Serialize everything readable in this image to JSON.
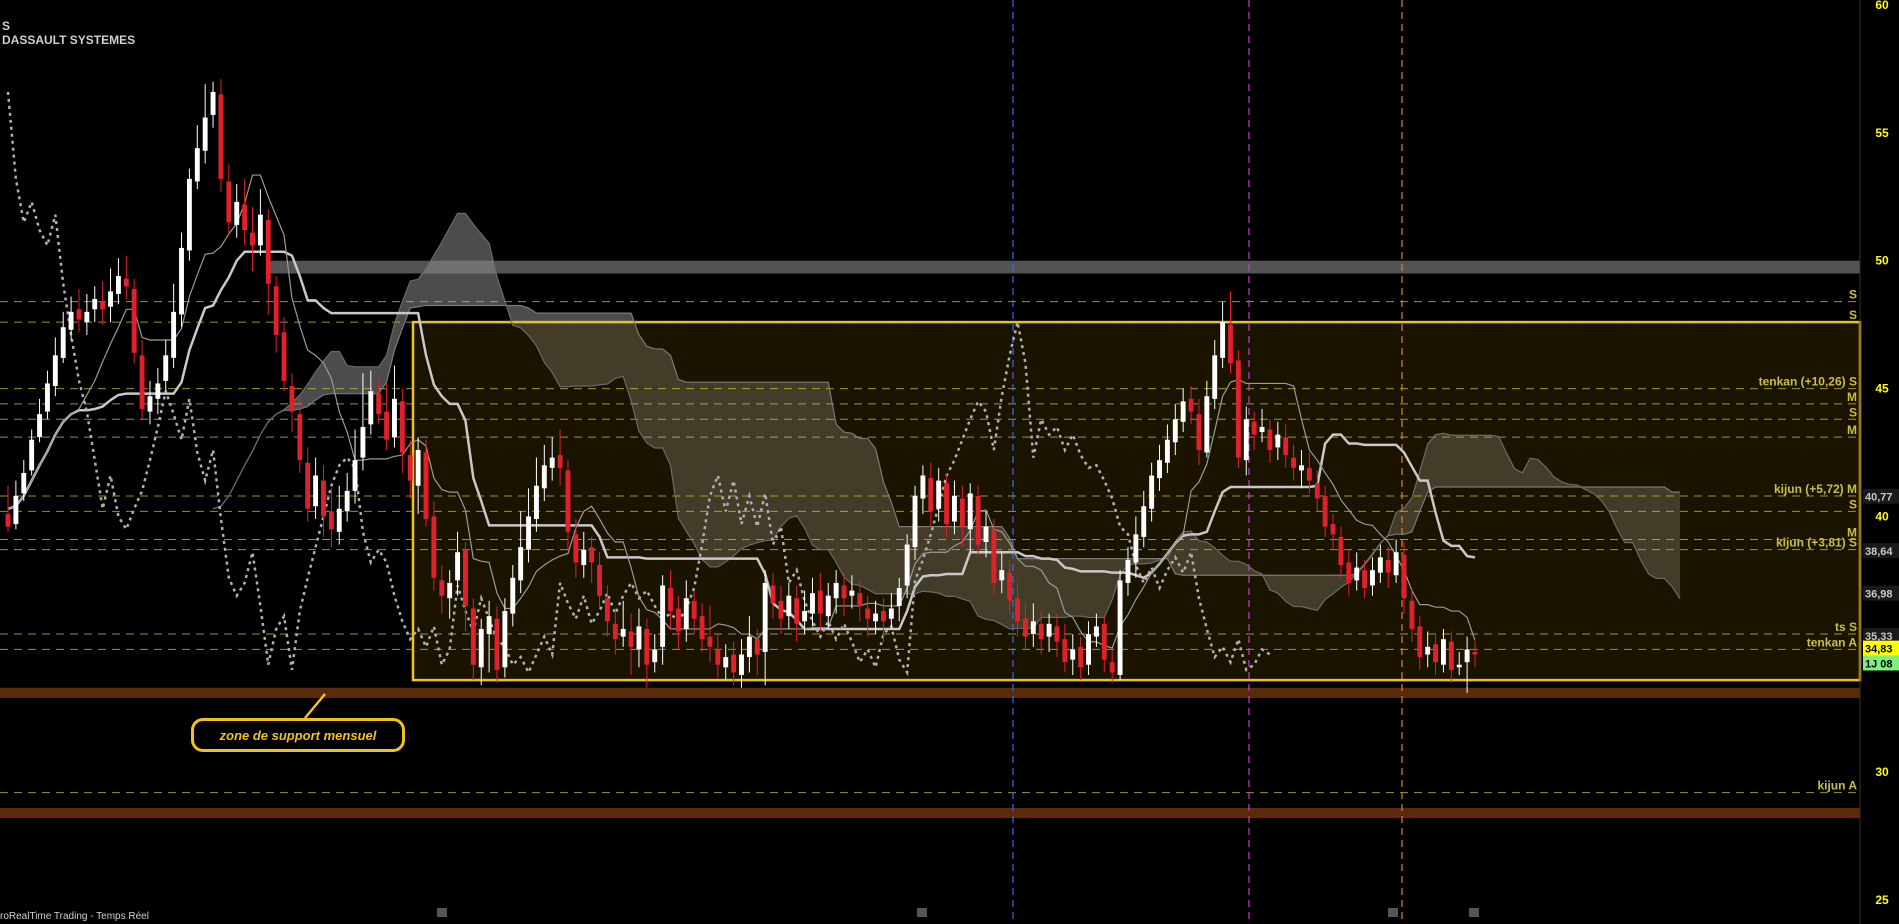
{
  "header": {
    "ticker": "S",
    "name": "DASSAULT SYSTEMES"
  },
  "footer": {
    "source": "roRealTime Trading - Temps Réel"
  },
  "annotation": {
    "label": "zone de support mensuel"
  },
  "colors": {
    "background": "#000000",
    "up_candle": "#ffffff",
    "down_candle": "#e0202a",
    "range_box": "#f0c21c",
    "level_line": "#c8c23a",
    "support_band": "#5a2a0a",
    "cloud": "#8a8a8a",
    "label_yellow": "#ffff00",
    "label_green": "#7ef07e"
  },
  "chart_data": {
    "type": "candlestick",
    "title": "DASSAULT SYSTEMES",
    "ylim": [
      25,
      60
    ],
    "y_ticks": [
      25,
      30,
      40,
      45,
      50,
      55,
      60
    ],
    "grid": false,
    "price_labels": [
      {
        "text": "40,77",
        "value": 40.77,
        "style": "gray"
      },
      {
        "text": "38,64",
        "value": 38.64,
        "style": "gray"
      },
      {
        "text": "36,98",
        "value": 36.98,
        "style": "gray"
      },
      {
        "text": "35,33",
        "value": 35.33,
        "style": "gray"
      },
      {
        "text": "34,83",
        "value": 34.83,
        "style": "yellow"
      },
      {
        "text": "1J 08",
        "value": 34.25,
        "style": "green"
      }
    ],
    "level_lines": [
      {
        "label": "S",
        "value": 48.4
      },
      {
        "label": "S",
        "value": 47.6
      },
      {
        "label": "tenkan (+10,26) S",
        "value": 45.0
      },
      {
        "label": "M",
        "value": 44.4
      },
      {
        "label": "S",
        "value": 43.8
      },
      {
        "label": "M",
        "value": 43.1
      },
      {
        "label": "kijun (+5,72) M",
        "value": 40.8
      },
      {
        "label": "S",
        "value": 40.2
      },
      {
        "label": "M",
        "value": 39.1
      },
      {
        "label": "kijun (+3,81) S",
        "value": 38.7
      },
      {
        "label": "ts S",
        "value": 35.4
      },
      {
        "label": "tenkan A",
        "value": 34.8
      },
      {
        "label": "kijun A",
        "value": 29.2
      }
    ],
    "range_box": {
      "top": 47.6,
      "bottom": 33.6
    },
    "resistance_band": {
      "top": 50.0,
      "bottom": 49.5
    },
    "support_zones": [
      {
        "top": 33.3,
        "bottom": 32.9
      },
      {
        "top": 28.6,
        "bottom": 28.2
      }
    ],
    "vertical_markers": [
      {
        "color": "#3a6fd8"
      },
      {
        "color": "#c040c0"
      },
      {
        "color": "#d08a2a"
      }
    ],
    "candles": [
      [
        40.1,
        39.6,
        41.2,
        39.4
      ],
      [
        39.7,
        40.8,
        41.4,
        39.5
      ],
      [
        40.9,
        41.7,
        42.2,
        40.6
      ],
      [
        41.8,
        43.0,
        43.4,
        41.6
      ],
      [
        43.1,
        44.0,
        44.6,
        42.9
      ],
      [
        44.1,
        45.2,
        45.7,
        43.8
      ],
      [
        45.1,
        46.3,
        47.0,
        44.7
      ],
      [
        46.2,
        47.4,
        48.0,
        46.0
      ],
      [
        47.3,
        48.0,
        48.6,
        46.9
      ],
      [
        48.1,
        47.7,
        48.9,
        47.2
      ],
      [
        47.6,
        48.0,
        48.7,
        47.1
      ],
      [
        48.1,
        48.5,
        49.0,
        47.6
      ],
      [
        48.4,
        48.1,
        49.2,
        47.5
      ],
      [
        48.2,
        48.8,
        49.7,
        47.6
      ],
      [
        48.7,
        49.4,
        50.1,
        48.3
      ],
      [
        49.3,
        49.0,
        50.2,
        48.5
      ],
      [
        48.9,
        46.4,
        49.3,
        46.0
      ],
      [
        46.3,
        44.2,
        46.9,
        43.8
      ],
      [
        44.1,
        44.7,
        45.3,
        43.6
      ],
      [
        44.6,
        45.2,
        45.8,
        44.0
      ],
      [
        45.3,
        46.3,
        46.9,
        45.0
      ],
      [
        46.2,
        48.0,
        49.1,
        45.8
      ],
      [
        47.9,
        50.5,
        51.1,
        47.4
      ],
      [
        50.4,
        53.2,
        53.6,
        50.0
      ],
      [
        53.1,
        54.4,
        55.3,
        52.8
      ],
      [
        54.3,
        55.6,
        56.9,
        53.8
      ],
      [
        55.7,
        56.6,
        57.0,
        55.2
      ],
      [
        56.5,
        53.2,
        57.1,
        52.7
      ],
      [
        53.1,
        51.5,
        53.8,
        51.0
      ],
      [
        51.4,
        52.3,
        53.0,
        50.9
      ],
      [
        52.2,
        51.2,
        53.2,
        50.6
      ],
      [
        51.1,
        50.6,
        52.1,
        49.6
      ],
      [
        50.6,
        51.8,
        52.8,
        50.2
      ],
      [
        51.6,
        49.1,
        52.0,
        47.9
      ],
      [
        49.0,
        47.1,
        49.4,
        46.4
      ],
      [
        47.2,
        45.3,
        47.8,
        44.9
      ],
      [
        45.1,
        44.1,
        45.6,
        43.3
      ],
      [
        44.0,
        42.2,
        44.6,
        41.7
      ],
      [
        42.1,
        40.3,
        42.7,
        39.8
      ],
      [
        40.4,
        41.6,
        42.3,
        39.9
      ],
      [
        41.4,
        40.0,
        42.0,
        39.2
      ],
      [
        40.2,
        39.5,
        41.1,
        38.8
      ],
      [
        39.4,
        40.3,
        41.2,
        38.9
      ],
      [
        40.2,
        41.0,
        41.7,
        39.8
      ],
      [
        41.0,
        42.2,
        43.4,
        40.5
      ],
      [
        42.3,
        43.5,
        45.6,
        41.8
      ],
      [
        43.6,
        44.9,
        45.7,
        43.2
      ],
      [
        44.8,
        44.0,
        45.4,
        43.6
      ],
      [
        44.1,
        43.0,
        45.2,
        42.6
      ],
      [
        43.1,
        44.6,
        45.9,
        42.7
      ],
      [
        44.5,
        42.5,
        45.0,
        41.7
      ],
      [
        42.4,
        41.4,
        43.0,
        40.7
      ],
      [
        41.2,
        42.6,
        43.1,
        40.1
      ],
      [
        42.5,
        39.9,
        43.0,
        39.6
      ],
      [
        40.0,
        37.6,
        40.6,
        37.1
      ],
      [
        37.5,
        36.9,
        38.1,
        36.2
      ],
      [
        36.8,
        37.4,
        37.9,
        36.0
      ],
      [
        37.5,
        38.6,
        39.4,
        36.9
      ],
      [
        38.7,
        36.5,
        39.0,
        35.5
      ],
      [
        36.4,
        34.2,
        36.8,
        33.6
      ],
      [
        34.1,
        35.6,
        36.0,
        33.4
      ],
      [
        35.4,
        36.1,
        36.7,
        33.9
      ],
      [
        36.0,
        34.0,
        36.5,
        33.5
      ],
      [
        34.1,
        36.3,
        36.8,
        33.7
      ],
      [
        36.2,
        37.6,
        38.1,
        35.7
      ],
      [
        37.5,
        38.8,
        40.2,
        37.0
      ],
      [
        38.7,
        40.0,
        41.1,
        38.2
      ],
      [
        39.9,
        41.2,
        42.3,
        39.4
      ],
      [
        41.1,
        42.0,
        42.8,
        40.6
      ],
      [
        41.9,
        42.3,
        43.1,
        41.4
      ],
      [
        42.4,
        41.9,
        43.4,
        41.2
      ],
      [
        41.8,
        39.4,
        42.2,
        38.7
      ],
      [
        39.3,
        38.2,
        39.9,
        37.6
      ],
      [
        38.1,
        38.7,
        39.4,
        37.6
      ],
      [
        38.8,
        38.2,
        39.2,
        37.4
      ],
      [
        38.1,
        36.9,
        38.6,
        36.4
      ],
      [
        36.8,
        35.9,
        37.3,
        35.3
      ],
      [
        35.8,
        35.2,
        36.4,
        34.6
      ],
      [
        35.3,
        35.6,
        36.7,
        34.9
      ],
      [
        35.5,
        34.9,
        36.2,
        33.8
      ],
      [
        34.8,
        35.7,
        36.4,
        34.1
      ],
      [
        35.6,
        34.2,
        36.0,
        33.3
      ],
      [
        34.3,
        34.8,
        35.4,
        33.9
      ],
      [
        34.9,
        37.3,
        37.7,
        34.2
      ],
      [
        37.2,
        36.3,
        37.9,
        35.6
      ],
      [
        36.4,
        35.5,
        36.9,
        34.8
      ],
      [
        35.6,
        36.8,
        37.5,
        35.1
      ],
      [
        36.7,
        36.0,
        37.1,
        35.4
      ],
      [
        36.1,
        35.2,
        36.6,
        34.7
      ],
      [
        35.3,
        34.9,
        36.5,
        34.3
      ],
      [
        34.8,
        34.2,
        35.4,
        33.7
      ],
      [
        34.1,
        34.5,
        35.0,
        33.6
      ],
      [
        34.6,
        33.9,
        35.1,
        33.4
      ],
      [
        33.8,
        34.6,
        35.2,
        33.3
      ],
      [
        34.5,
        35.3,
        36.1,
        33.9
      ],
      [
        35.2,
        34.6,
        35.6,
        33.8
      ],
      [
        34.7,
        37.4,
        37.9,
        33.4
      ],
      [
        37.3,
        36.6,
        37.8,
        36.0
      ],
      [
        36.7,
        36.0,
        37.3,
        35.4
      ],
      [
        36.1,
        36.9,
        37.4,
        35.6
      ],
      [
        36.8,
        35.8,
        37.3,
        35.1
      ],
      [
        35.9,
        36.3,
        37.1,
        35.4
      ],
      [
        36.2,
        37.0,
        37.6,
        35.7
      ],
      [
        37.1,
        36.2,
        37.8,
        35.5
      ],
      [
        36.1,
        36.9,
        37.4,
        35.6
      ],
      [
        36.8,
        37.4,
        37.9,
        36.2
      ],
      [
        37.3,
        36.8,
        37.8,
        36.1
      ],
      [
        36.9,
        37.1,
        37.7,
        36.4
      ],
      [
        37.0,
        36.5,
        37.5,
        35.9
      ],
      [
        36.4,
        36.0,
        36.9,
        35.3
      ],
      [
        35.9,
        36.2,
        36.7,
        35.4
      ],
      [
        36.3,
        35.9,
        36.8,
        35.1
      ],
      [
        36.0,
        36.4,
        37.0,
        35.6
      ],
      [
        36.5,
        37.2,
        37.6,
        35.9
      ],
      [
        37.3,
        38.9,
        39.3,
        36.8
      ],
      [
        38.8,
        40.8,
        41.2,
        38.3
      ],
      [
        40.7,
        41.6,
        42.0,
        40.1
      ],
      [
        41.5,
        40.2,
        42.1,
        39.6
      ],
      [
        40.3,
        41.4,
        41.9,
        39.8
      ],
      [
        41.3,
        39.7,
        41.7,
        39.2
      ],
      [
        39.8,
        40.8,
        41.4,
        39.3
      ],
      [
        40.7,
        39.6,
        41.2,
        38.8
      ],
      [
        39.5,
        40.9,
        41.3,
        38.6
      ],
      [
        40.8,
        38.9,
        41.2,
        38.5
      ],
      [
        39.0,
        39.6,
        40.2,
        38.4
      ],
      [
        39.5,
        37.4,
        39.9,
        36.9
      ],
      [
        37.5,
        37.9,
        38.6,
        37.0
      ],
      [
        37.8,
        36.7,
        38.3,
        36.2
      ],
      [
        36.8,
        35.9,
        37.4,
        35.3
      ],
      [
        36.0,
        35.3,
        36.6,
        34.8
      ],
      [
        35.4,
        35.9,
        36.6,
        34.9
      ],
      [
        35.8,
        35.2,
        36.3,
        34.6
      ],
      [
        35.3,
        35.8,
        36.2,
        34.7
      ],
      [
        35.7,
        35.1,
        36.2,
        34.5
      ],
      [
        35.2,
        34.3,
        35.8,
        33.9
      ],
      [
        34.4,
        34.8,
        35.4,
        33.8
      ],
      [
        34.9,
        34.1,
        35.3,
        33.6
      ],
      [
        34.2,
        35.4,
        35.9,
        33.8
      ],
      [
        35.3,
        35.7,
        36.2,
        34.9
      ],
      [
        35.8,
        34.4,
        36.1,
        33.9
      ],
      [
        34.3,
        33.9,
        34.8,
        33.5
      ],
      [
        33.8,
        37.5,
        37.9,
        33.6
      ],
      [
        37.4,
        38.3,
        38.8,
        36.9
      ],
      [
        38.2,
        39.3,
        40.0,
        37.6
      ],
      [
        39.2,
        40.4,
        41.0,
        38.8
      ],
      [
        40.3,
        41.6,
        42.1,
        39.8
      ],
      [
        41.5,
        42.2,
        42.8,
        41.0
      ],
      [
        42.1,
        43.0,
        43.6,
        41.7
      ],
      [
        42.9,
        43.8,
        44.4,
        42.4
      ],
      [
        43.7,
        44.5,
        45.0,
        43.3
      ],
      [
        44.6,
        44.1,
        45.1,
        43.6
      ],
      [
        44.0,
        42.6,
        44.6,
        42.0
      ],
      [
        42.5,
        44.7,
        45.3,
        42.3
      ],
      [
        44.6,
        46.3,
        46.9,
        44.2
      ],
      [
        46.2,
        47.6,
        48.4,
        45.8
      ],
      [
        47.5,
        46.0,
        48.8,
        45.6
      ],
      [
        46.1,
        42.3,
        46.5,
        41.9
      ],
      [
        42.2,
        43.8,
        44.3,
        41.6
      ],
      [
        43.7,
        43.2,
        44.1,
        42.6
      ],
      [
        43.3,
        43.5,
        44.2,
        42.9
      ],
      [
        43.4,
        42.6,
        43.8,
        42.1
      ],
      [
        42.7,
        43.2,
        43.7,
        42.2
      ],
      [
        43.1,
        42.4,
        43.6,
        41.9
      ],
      [
        42.3,
        41.9,
        42.8,
        41.4
      ],
      [
        41.8,
        42.0,
        42.6,
        41.1
      ],
      [
        41.9,
        41.4,
        42.5,
        40.9
      ],
      [
        41.3,
        40.7,
        41.8,
        40.2
      ],
      [
        40.8,
        39.6,
        41.2,
        39.2
      ],
      [
        39.7,
        39.3,
        40.1,
        38.7
      ],
      [
        39.2,
        38.1,
        39.6,
        37.6
      ],
      [
        38.2,
        37.4,
        38.7,
        36.9
      ],
      [
        37.5,
        38.0,
        38.6,
        37.1
      ],
      [
        37.9,
        37.2,
        38.3,
        36.8
      ],
      [
        37.3,
        37.9,
        38.4,
        36.9
      ],
      [
        37.8,
        38.4,
        38.9,
        37.4
      ],
      [
        38.3,
        37.8,
        38.8,
        37.2
      ],
      [
        37.7,
        38.6,
        39.1,
        37.4
      ],
      [
        38.5,
        36.8,
        39.0,
        36.2
      ],
      [
        36.7,
        35.6,
        37.2,
        35.1
      ],
      [
        35.7,
        34.5,
        36.1,
        34.0
      ],
      [
        34.6,
        34.9,
        35.5,
        34.1
      ],
      [
        35.0,
        34.3,
        35.4,
        33.8
      ],
      [
        34.2,
        35.2,
        35.6,
        33.9
      ],
      [
        35.1,
        34.0,
        35.5,
        33.5
      ],
      [
        34.1,
        34.2,
        34.7,
        33.8
      ],
      [
        34.3,
        34.8,
        35.3,
        33.1
      ],
      [
        34.7,
        34.6,
        35.1,
        34.1
      ]
    ]
  }
}
